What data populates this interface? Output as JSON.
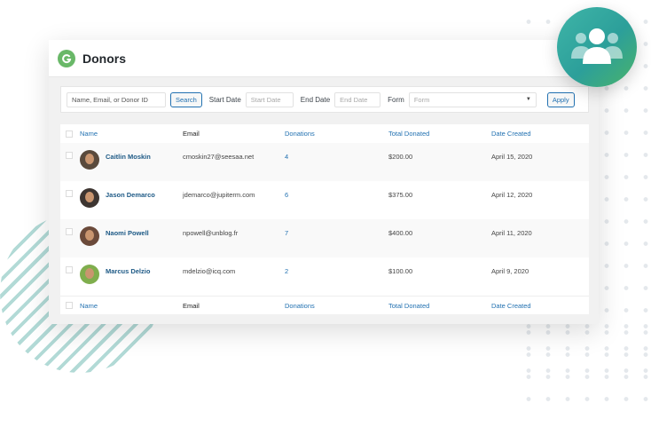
{
  "app": {
    "title": "Donors"
  },
  "filters": {
    "search_placeholder": "Name, Email, or Donor ID",
    "search_button": "Search",
    "start_date_label": "Start Date",
    "start_date_placeholder": "Start Date",
    "end_date_label": "End Date",
    "end_date_placeholder": "End Date",
    "form_label": "Form",
    "form_value": "Form",
    "apply_button": "Apply"
  },
  "table": {
    "columns": [
      "Name",
      "Email",
      "Donations",
      "Total Donated",
      "Date Created"
    ],
    "rows": [
      {
        "name": "Caitlin Moskin",
        "email": "cmoskin27@seesaa.net",
        "donations": "4",
        "total": "$200.00",
        "date": "April 15, 2020",
        "avatar_color": "#5a4a3c"
      },
      {
        "name": "Jason Demarco",
        "email": "jdemarco@jupiterm.com",
        "donations": "6",
        "total": "$375.00",
        "date": "April 12, 2020",
        "avatar_color": "#3d3531"
      },
      {
        "name": "Naomi Powell",
        "email": "npowell@unblog.fr",
        "donations": "7",
        "total": "$400.00",
        "date": "April 11, 2020",
        "avatar_color": "#6b4a3a"
      },
      {
        "name": "Marcus Delzio",
        "email": "mdelzio@icq.com",
        "donations": "2",
        "total": "$100.00",
        "date": "April 9, 2020",
        "avatar_color": "#7fae4d"
      }
    ]
  },
  "icons": {
    "badge": "users-group-icon",
    "logo": "give-logo-icon"
  },
  "colors": {
    "accent": "#2271b1",
    "brand_green": "#69b868",
    "badge_teal": "#3fb5a8"
  }
}
